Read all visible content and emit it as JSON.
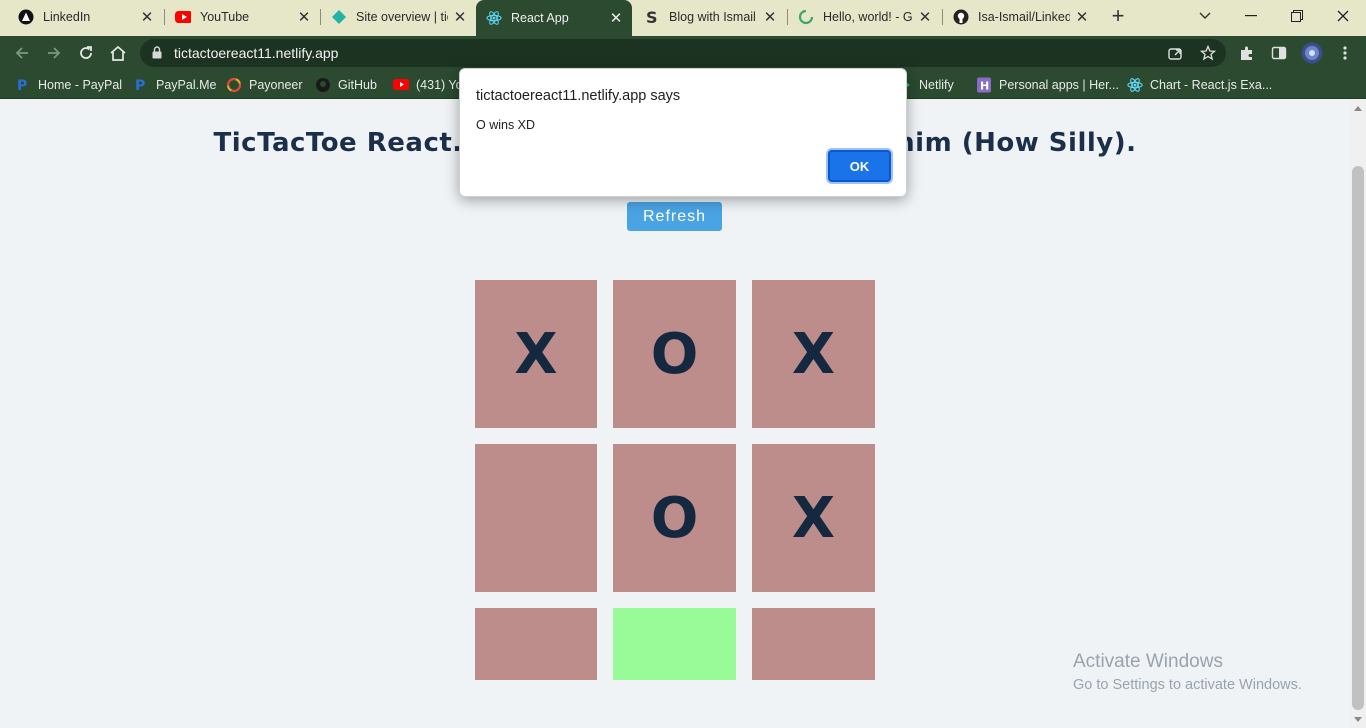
{
  "browser": {
    "tabs": [
      {
        "title": "LinkedIn",
        "icon": "linkedin-icon"
      },
      {
        "title": "YouTube",
        "icon": "youtube-icon"
      },
      {
        "title": "Site overview | tic",
        "icon": "netlify-icon"
      },
      {
        "title": "React App",
        "icon": "react-icon",
        "active": true
      },
      {
        "title": "Blog with Ismail -",
        "icon": "s-icon"
      },
      {
        "title": "Hello, world! - Gr",
        "icon": "loading-icon"
      },
      {
        "title": "Isa-Ismail/Linked",
        "icon": "github-icon"
      }
    ],
    "url": "tictactoereact11.netlify.app",
    "bookmarks": [
      {
        "label": "Home - PayPal",
        "icon": "paypal-icon"
      },
      {
        "label": "PayPal.Me",
        "icon": "paypal-icon"
      },
      {
        "label": "Payoneer",
        "icon": "payoneer-icon"
      },
      {
        "label": "GitHub",
        "icon": "github-icon"
      },
      {
        "label": "(431) Yo",
        "icon": "youtube-icon"
      },
      {
        "label": "Netlify",
        "icon": "netlify-icon"
      },
      {
        "label": "Personal apps | Her...",
        "icon": "heroku-icon"
      },
      {
        "label": "Chart - React.js Exa...",
        "icon": "react-icon"
      }
    ]
  },
  "page": {
    "heading": "TicTacToe React.Js Tr                                   Fahim (How Silly).",
    "refresh_label": "Refresh",
    "board": [
      "X",
      "O",
      "X",
      "",
      "O",
      "X",
      "",
      "",
      ""
    ],
    "hovered_cell_index": 7
  },
  "dialog": {
    "origin": "tictactoereact11.netlify.app says",
    "message": "O wins XD",
    "ok_label": "OK"
  },
  "watermark": {
    "line1": "Activate Windows",
    "line2": "Go to Settings to activate Windows."
  },
  "colors": {
    "tab_strip": "#e6e6c8",
    "toolbar": "#2b4a30",
    "page_bg": "#eff3f6",
    "cell": "#bd8d8c",
    "cell_hover": "#98fb98",
    "mark": "#14283f",
    "refresh_button": "#4aa3e2",
    "dialog_ok": "#1a73e8"
  }
}
